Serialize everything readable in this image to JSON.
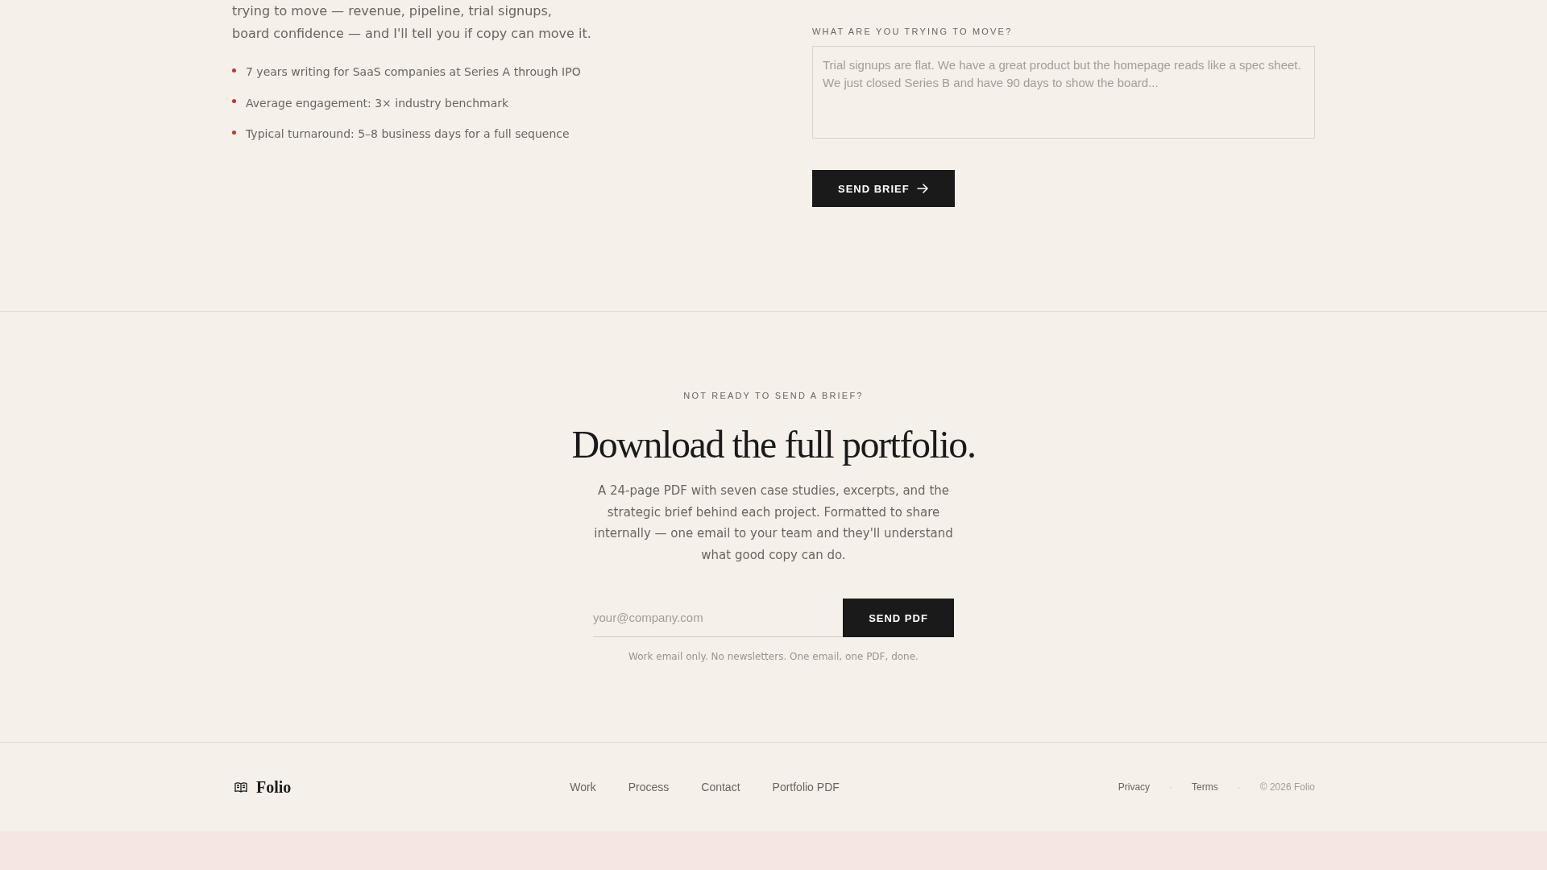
{
  "intro": {
    "text": "trying to move — revenue, pipeline, trial signups, board confidence — and I'll tell you if copy can move it.",
    "facts": [
      "7 years writing for SaaS companies at Series A through IPO",
      "Average engagement: 3× industry benchmark",
      "Typical turnaround: 5–8 business days for a full sequence"
    ]
  },
  "brief_form": {
    "field_label": "WHAT ARE YOU TRYING TO MOVE?",
    "placeholder": "Trial signups are flat. We have a great product but the homepage reads like a spec sheet. We just closed Series B and have 90 days to show the board...",
    "submit": "SEND BRIEF"
  },
  "portfolio_offer": {
    "eyebrow": "NOT READY TO SEND A BRIEF?",
    "title": "Download the full portfolio.",
    "description": "A 24-page PDF with seven case studies, excerpts, and the strategic brief behind each project. Formatted to share internally — one email to your team and they'll understand what good copy can do.",
    "email_placeholder": "your@company.com",
    "submit": "SEND PDF",
    "note": "Work email only. No newsletters. One email, one PDF, done."
  },
  "footer": {
    "brand": "Folio",
    "nav": [
      "Work",
      "Process",
      "Contact",
      "Portfolio PDF"
    ],
    "legal": [
      {
        "kind": "link",
        "text": "Privacy"
      },
      {
        "kind": "separator",
        "text": "·"
      },
      {
        "kind": "link",
        "text": "Terms"
      },
      {
        "kind": "separator",
        "text": "·"
      },
      {
        "kind": "copyright",
        "text": "© 2026 Folio"
      }
    ]
  }
}
